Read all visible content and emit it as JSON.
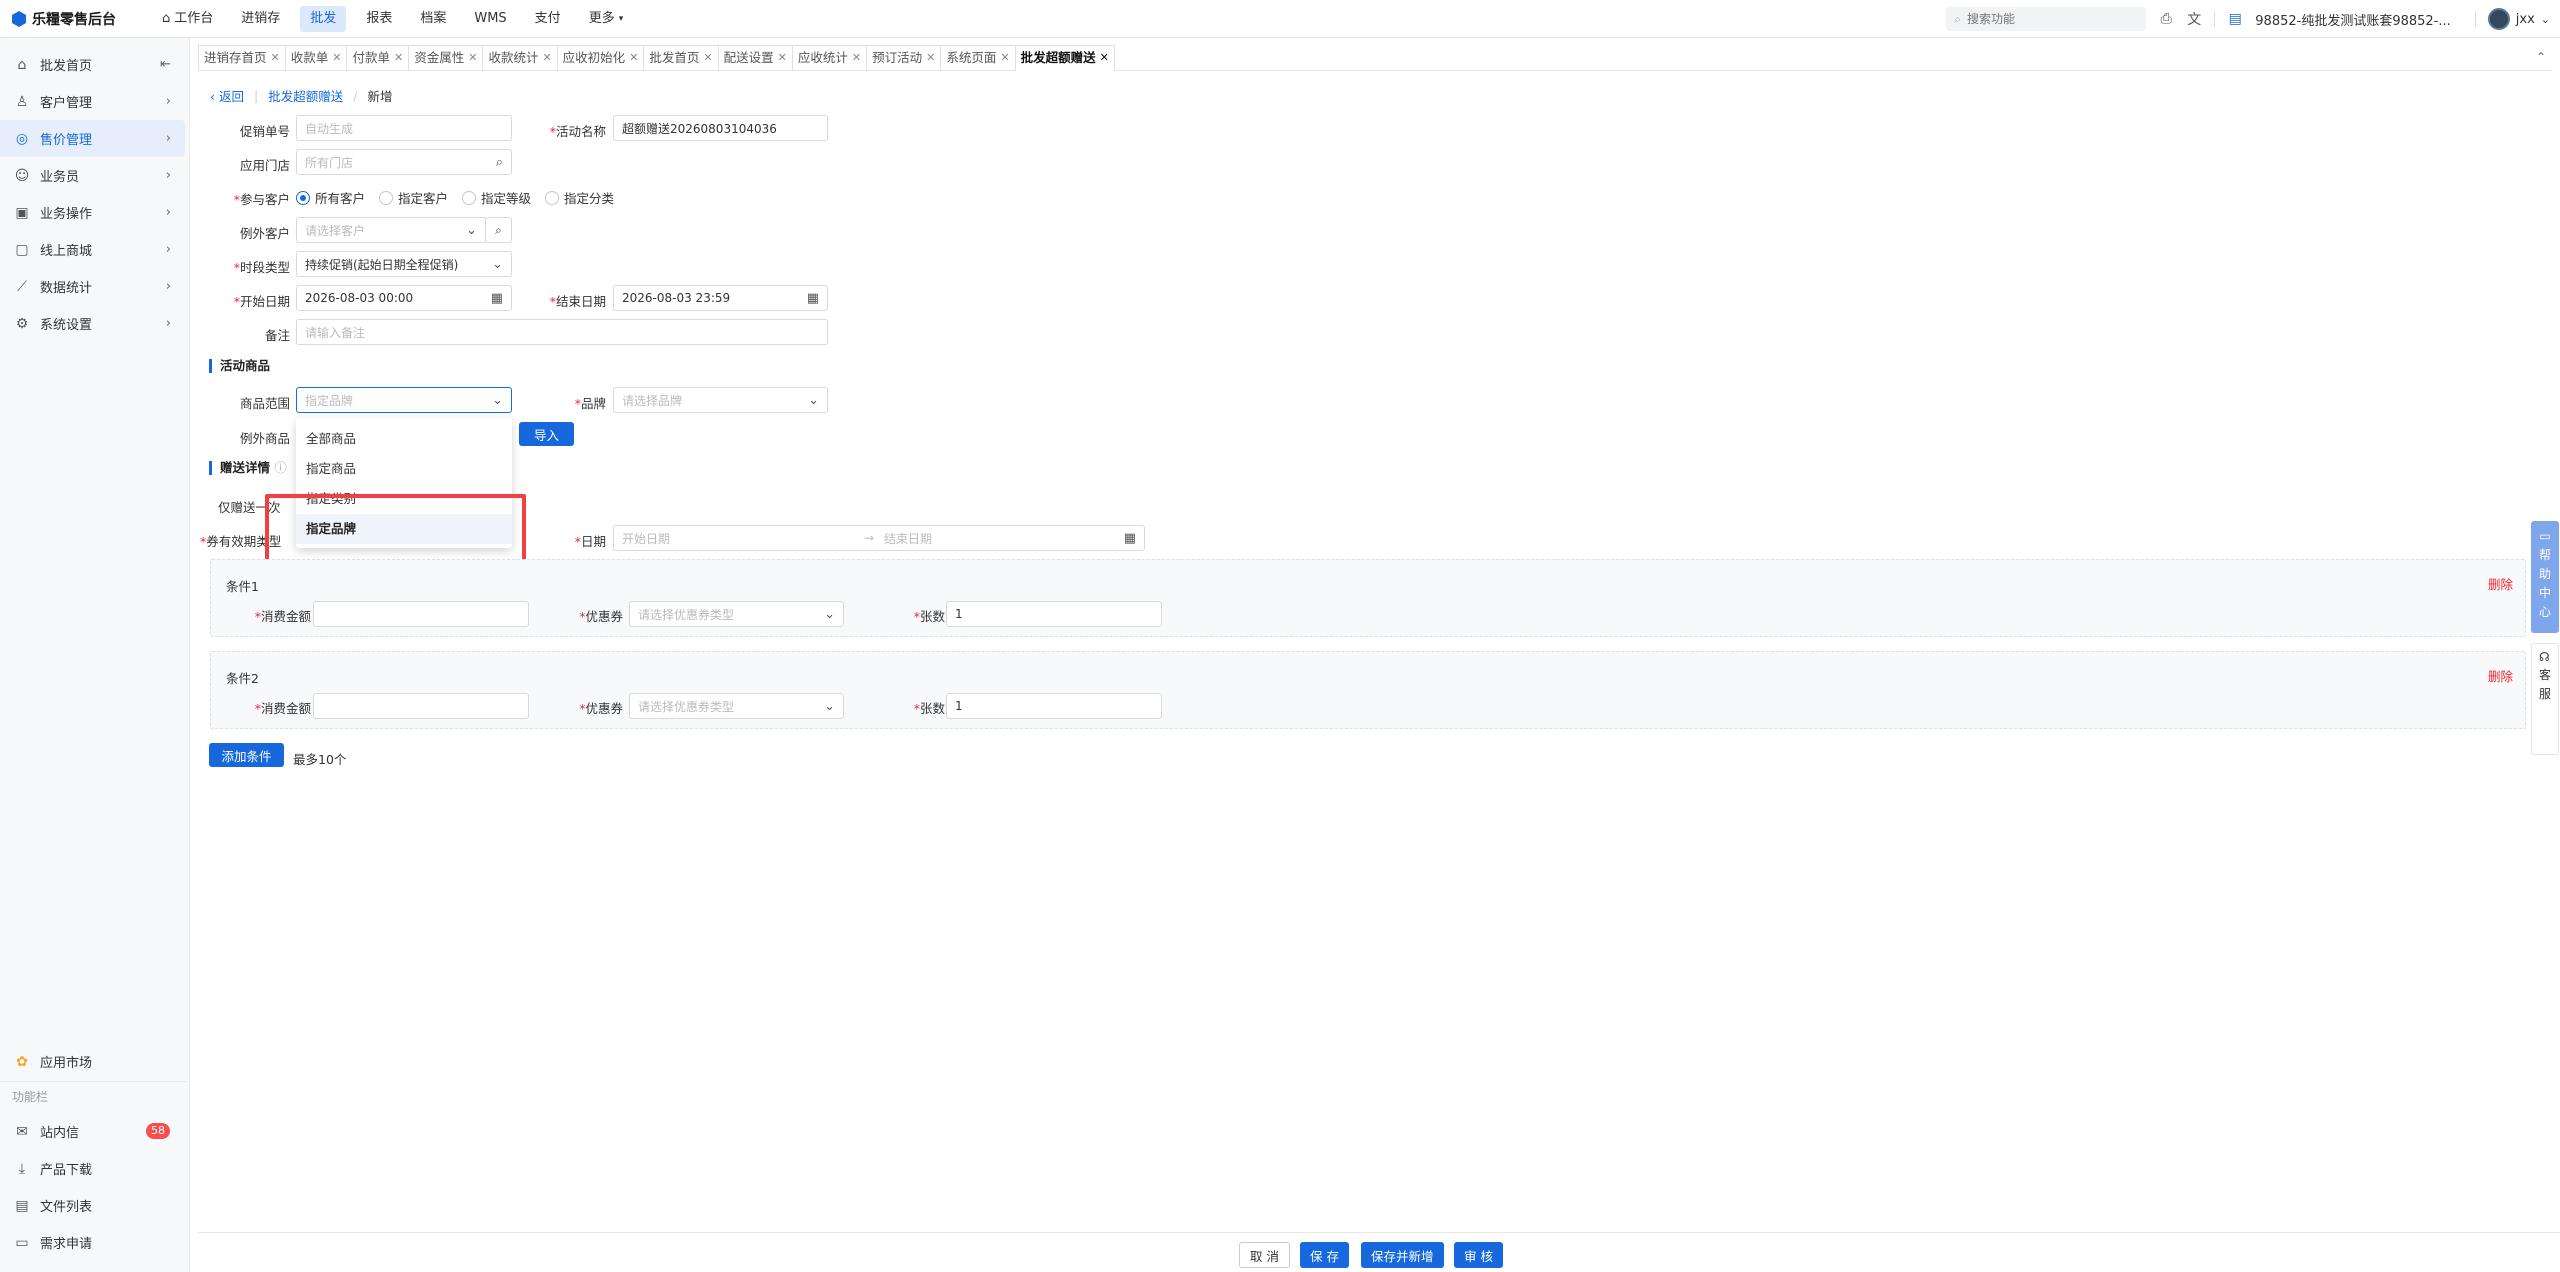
{
  "app": {
    "title": "乐糧零售后台"
  },
  "topnav": {
    "items": [
      {
        "label": "工作台",
        "icon": "home-icon"
      },
      {
        "label": "进销存"
      },
      {
        "label": "批发",
        "active": true
      },
      {
        "label": "报表"
      },
      {
        "label": "档案"
      },
      {
        "label": "WMS"
      },
      {
        "label": "支付"
      },
      {
        "label": "更多"
      }
    ],
    "search_placeholder": "搜索功能",
    "account": "98852-纯批发测试账套98852-...",
    "user": "jxx"
  },
  "sidebar": {
    "items": [
      {
        "label": "批发首页",
        "icon": "home-icon"
      },
      {
        "label": "客户管理",
        "icon": "user-icon"
      },
      {
        "label": "售价管理",
        "icon": "price-icon",
        "active": true
      },
      {
        "label": "业务员",
        "icon": "person-icon"
      },
      {
        "label": "业务操作",
        "icon": "operation-icon"
      },
      {
        "label": "线上商城",
        "icon": "store-icon"
      },
      {
        "label": "数据统计",
        "icon": "chart-icon"
      },
      {
        "label": "系统设置",
        "icon": "settings-icon"
      }
    ],
    "app_market": "应用市场",
    "section_label": "功能栏",
    "bottom": [
      {
        "label": "站内信",
        "icon": "mail-icon",
        "badge": "58"
      },
      {
        "label": "产品下载",
        "icon": "download-icon"
      },
      {
        "label": "文件列表",
        "icon": "file-icon"
      },
      {
        "label": "需求申请",
        "icon": "request-icon"
      }
    ]
  },
  "tabs": [
    {
      "label": "进销存首页"
    },
    {
      "label": "收款单"
    },
    {
      "label": "付款单"
    },
    {
      "label": "资金属性"
    },
    {
      "label": "收款统计"
    },
    {
      "label": "应收初始化"
    },
    {
      "label": "批发首页"
    },
    {
      "label": "配送设置"
    },
    {
      "label": "应收统计"
    },
    {
      "label": "预订活动"
    },
    {
      "label": "系统页面"
    },
    {
      "label": "批发超额赠送",
      "active": true
    }
  ],
  "breadcrumb": {
    "back": "返回",
    "parent": "批发超额赠送",
    "current": "新增"
  },
  "form": {
    "promo_no_label": "促销单号",
    "promo_no_placeholder": "自动生成",
    "activity_name_label": "活动名称",
    "activity_name_value": "超额赠送20260803104036",
    "store_label": "应用门店",
    "store_placeholder": "所有门店",
    "participant_label": "参与客户",
    "participant_options": [
      "所有客户",
      "指定客户",
      "指定等级",
      "指定分类"
    ],
    "exclude_customer_label": "例外客户",
    "exclude_customer_placeholder": "请选择客户",
    "period_type_label": "时段类型",
    "period_type_value": "持续促销(起始日期全程促销)",
    "start_date_label": "开始日期",
    "start_date_value": "2026-08-03 00:00",
    "end_date_label": "结束日期",
    "end_date_value": "2026-08-03 23:59",
    "remark_label": "备注",
    "remark_placeholder": "请输入备注"
  },
  "goods_section": {
    "title": "活动商品",
    "scope_label": "商品范围",
    "scope_placeholder": "指定品牌",
    "brand_label": "品牌",
    "brand_placeholder": "请选择品牌",
    "exclude_goods_label": "例外商品",
    "import_button": "导入",
    "dropdown_options": [
      "全部商品",
      "指定商品",
      "指定类别",
      "指定品牌"
    ],
    "dropdown_selected": "指定品牌"
  },
  "gift_section": {
    "title": "赠送详情",
    "once_label": "仅赠送一次",
    "validity_label": "券有效期类型",
    "date_label": "日期",
    "start_placeholder": "开始日期",
    "end_placeholder": "结束日期"
  },
  "conditions": [
    {
      "title": "条件1",
      "amount_label": "消费金额",
      "amount_value": "",
      "coupon_label": "优惠券",
      "coupon_placeholder": "请选择优惠券类型",
      "count_label": "张数",
      "count_value": "1",
      "delete": "删除"
    },
    {
      "title": "条件2",
      "amount_label": "消费金额",
      "amount_value": "",
      "coupon_label": "优惠券",
      "coupon_placeholder": "请选择优惠券类型",
      "count_label": "张数",
      "count_value": "1",
      "delete": "删除"
    }
  ],
  "add_condition": {
    "button": "添加条件",
    "hint": "最多10个"
  },
  "footer": {
    "cancel": "取 消",
    "save": "保 存",
    "save_new": "保存并新增",
    "audit": "审 核"
  },
  "side_widgets": {
    "help": [
      "帮",
      "助",
      "中",
      "心"
    ],
    "service": [
      "客",
      "服"
    ]
  },
  "colors": {
    "accent": "#1668dc",
    "required": "#f5222d",
    "highlight": "#f04040"
  }
}
